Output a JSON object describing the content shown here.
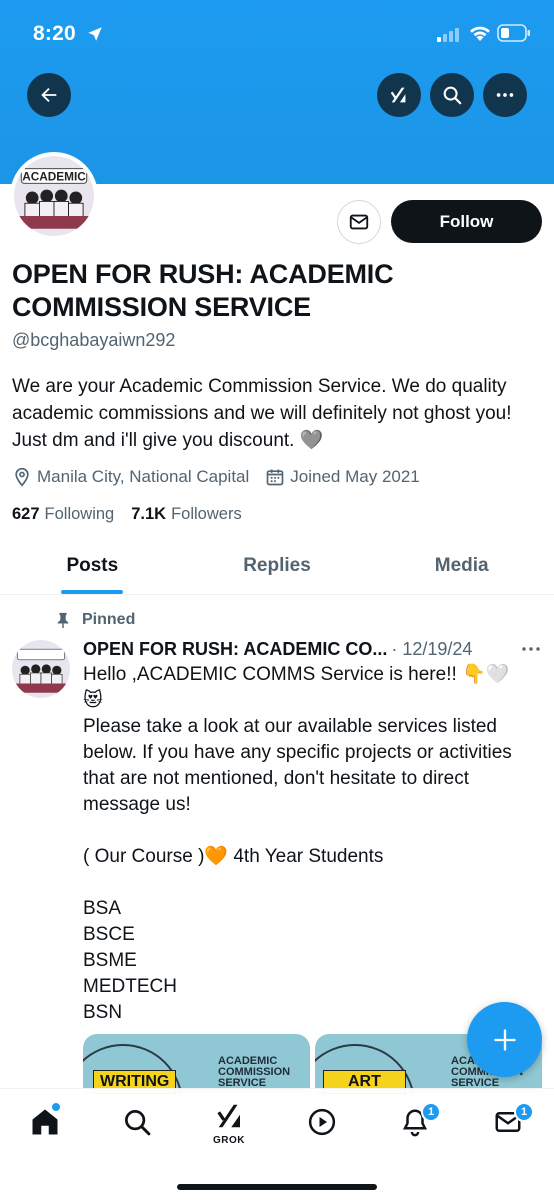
{
  "status_bar": {
    "time": "8:20"
  },
  "header": {
    "back_icon": "arrow-left-icon",
    "grok_icon": "grok-icon",
    "search_icon": "search-icon",
    "more_icon": "more-horizontal-icon"
  },
  "profile": {
    "avatar_text": "ACADEMIC",
    "name": "OPEN FOR RUSH: ACADEMIC COMMISSION SERVICE",
    "handle": "@bcghabayaiwn292",
    "bio": "We are your Academic Commission Service. We do quality academic commissions and we will definitely not ghost you! Just dm and i'll give you discount. 🩶",
    "location": "Manila City, National Capital",
    "joined": "Joined May 2021",
    "following_count": "627",
    "following_label": "Following",
    "followers_count": "7.1K",
    "followers_label": "Followers",
    "follow_label": "Follow"
  },
  "tabs": [
    {
      "label": "Posts",
      "active": true
    },
    {
      "label": "Replies",
      "active": false
    },
    {
      "label": "Media",
      "active": false
    }
  ],
  "post": {
    "pinned_label": "Pinned",
    "author": "OPEN FOR RUSH: ACADEMIC CO...",
    "date": "· 12/19/24",
    "body": "Hello ,ACADEMIC COMMS Service is here!! 👇🤍\n😻\nPlease take a look at our available services listed below. If you have any specific projects or activities that are not mentioned, don't hesitate to direct message us!\n\n( Our Course )🧡 4th Year Students\n\nBSA\nBSCE\nBSME\nMEDTECH\nBSN",
    "media": [
      {
        "title": "ACADEMIC\nCOMMISSION\nSERVICE",
        "label": "WRITING"
      },
      {
        "title": "ACADEMIC\nCOMMISSION\nSERVICE",
        "label": "ART"
      }
    ]
  },
  "bottom_nav": {
    "items": [
      "home-icon",
      "search-icon",
      "grok-icon",
      "video-icon",
      "notifications-icon",
      "messages-icon"
    ],
    "grok_label": "GROK",
    "notifications_badge": "1",
    "messages_badge": "1"
  },
  "colors": {
    "accent": "#1d9bf0",
    "text": "#0f1419",
    "secondary": "#536471"
  }
}
